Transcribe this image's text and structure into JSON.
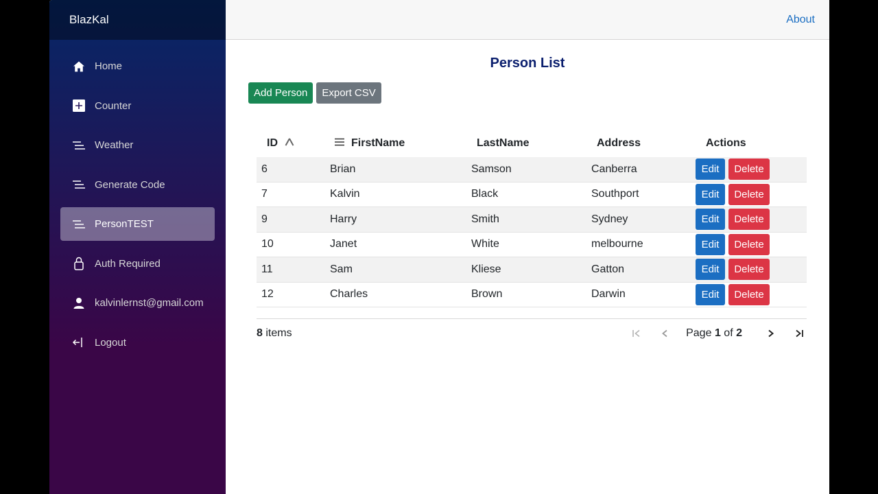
{
  "brand": "BlazKal",
  "nav": [
    {
      "label": "Home",
      "icon": "home-icon"
    },
    {
      "label": "Counter",
      "icon": "plus-square-icon"
    },
    {
      "label": "Weather",
      "icon": "list-lines-icon"
    },
    {
      "label": "Generate Code",
      "icon": "list-lines-icon"
    },
    {
      "label": "PersonTEST",
      "icon": "list-lines-icon",
      "active": true
    },
    {
      "label": "Auth Required",
      "icon": "lock-icon"
    },
    {
      "label": "kalvinlernst@gmail.com",
      "icon": "person-icon"
    },
    {
      "label": "Logout",
      "icon": "logout-icon"
    }
  ],
  "topbar": {
    "about": "About"
  },
  "page": {
    "title": "Person List"
  },
  "toolbar": {
    "add": "Add Person",
    "export": "Export CSV"
  },
  "table": {
    "headers": {
      "id": "ID",
      "first": "FirstName",
      "last": "LastName",
      "address": "Address",
      "actions": "Actions"
    },
    "rows": [
      {
        "id": "6",
        "first": "Brian",
        "last": "Samson",
        "address": "Canberra"
      },
      {
        "id": "7",
        "first": "Kalvin",
        "last": "Black",
        "address": "Southport"
      },
      {
        "id": "9",
        "first": "Harry",
        "last": "Smith",
        "address": "Sydney"
      },
      {
        "id": "10",
        "first": "Janet",
        "last": "White",
        "address": "melbourne"
      },
      {
        "id": "11",
        "first": "Sam",
        "last": "Kliese",
        "address": "Gatton"
      },
      {
        "id": "12",
        "first": "Charles",
        "last": "Brown",
        "address": "Darwin"
      }
    ],
    "edit_label": "Edit",
    "delete_label": "Delete"
  },
  "pager": {
    "count": "8",
    "items_label": "items",
    "page_prefix": "Page",
    "page": "1",
    "of_label": "of",
    "total_pages": "2"
  },
  "colors": {
    "edit": "#1b6ec2",
    "delete": "#dc3545",
    "add": "#198754",
    "export": "#6c757d",
    "title": "#0b1f6e"
  }
}
